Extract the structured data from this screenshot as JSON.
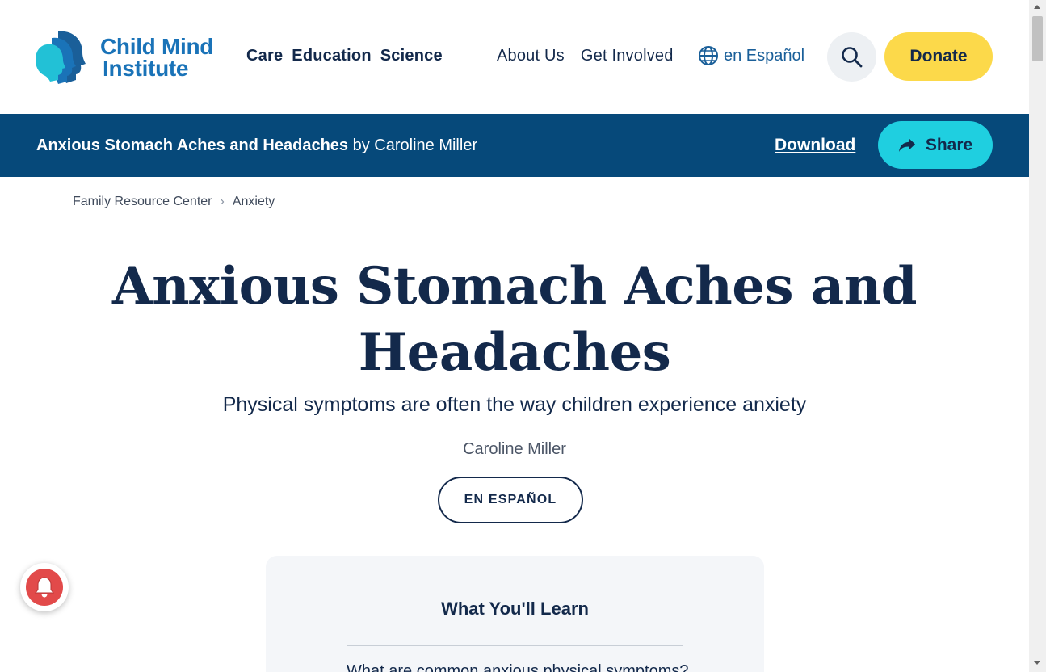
{
  "header": {
    "logo": {
      "line1": "Child Mind",
      "line2": "Institute"
    },
    "primary_nav": [
      "Care",
      "Education",
      "Science"
    ],
    "secondary_nav": [
      "About Us",
      "Get Involved"
    ],
    "language_link": "en Español",
    "search_icon": "search-icon",
    "donate_label": "Donate"
  },
  "article_bar": {
    "title": "Anxious Stomach Aches and Headaches",
    "byline": "by Caroline Miller",
    "download_label": "Download",
    "share_label": "Share"
  },
  "breadcrumb": {
    "items": [
      "Family Resource Center",
      "Anxiety"
    ]
  },
  "article": {
    "title_line1": "Anxious Stomach Aches and",
    "title_line2": "Headaches",
    "subtitle": "Physical symptoms are often the way children experience anxiety",
    "author": "Caroline Miller",
    "espanol_button": "EN ESPAÑOL"
  },
  "learn_card": {
    "title": "What You'll Learn",
    "first_item": "What are common anxious physical symptoms?"
  },
  "colors": {
    "navy": "#13294b",
    "article_bar": "#06497a",
    "donate": "#fcd94a",
    "share": "#1fcfe0",
    "logo_blue": "#1a73b8",
    "bell_red": "#e24a4a"
  }
}
